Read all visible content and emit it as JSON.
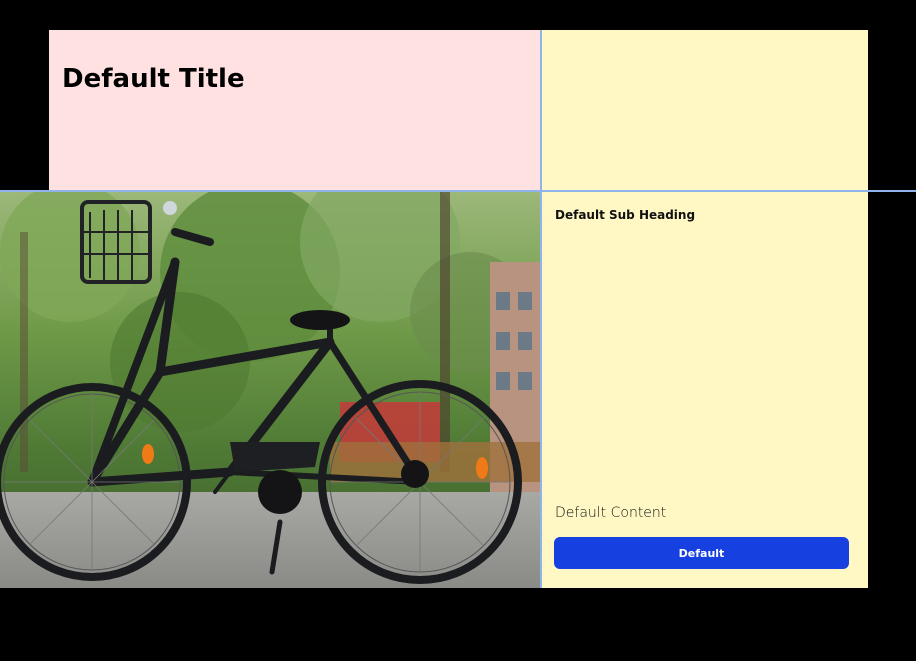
{
  "header": {
    "title": "Default Title"
  },
  "panel": {
    "sub_heading": "Default Sub Heading",
    "content": "Default Content",
    "button_label": "Default"
  },
  "image": {
    "subject": "bicycle-photo"
  },
  "colors": {
    "title_bg": "#ffe1e1",
    "panel_bg": "#fff8c4",
    "button_bg": "#1740e0",
    "grid_line": "#8fb3ea",
    "page_bg": "#000000"
  }
}
